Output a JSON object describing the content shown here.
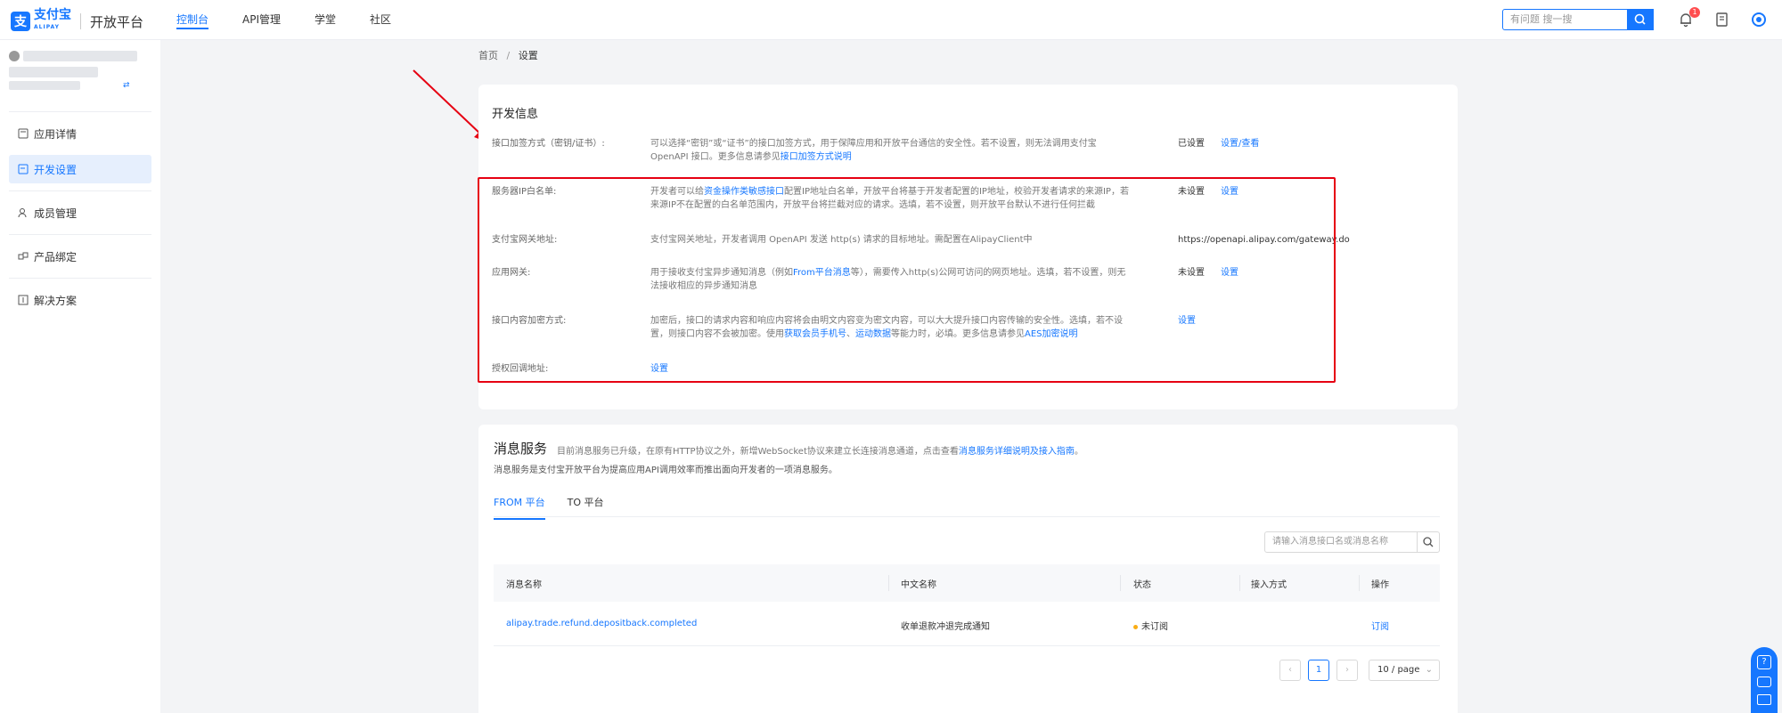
{
  "brand": {
    "mark": "支",
    "name": "支付宝",
    "sub": "ALIPAY",
    "product": "开放平台"
  },
  "nav": [
    {
      "label": "控制台",
      "active": true
    },
    {
      "label": "API管理",
      "active": false
    },
    {
      "label": "学堂",
      "active": false
    },
    {
      "label": "社区",
      "active": false
    }
  ],
  "search": {
    "placeholder": "有问题 搜一搜"
  },
  "notifications": {
    "count": "1"
  },
  "sidebar": {
    "items": [
      {
        "label": "应用详情",
        "active": false
      },
      {
        "label": "开发设置",
        "active": true
      },
      {
        "label": "成员管理",
        "active": false
      },
      {
        "label": "产品绑定",
        "active": false
      },
      {
        "label": "解决方案",
        "active": false
      }
    ]
  },
  "breadcrumb": {
    "home": "首页",
    "sep": "/",
    "current": "设置"
  },
  "dev": {
    "title": "开发信息",
    "rows": [
      {
        "label": "接口加签方式（密钥/证书）:",
        "desc": "可以选择“密钥”或“证书”的接口加签方式，用于保障应用和开放平台通信的安全性。若不设置，则无法调用支付宝 OpenAPI 接口。更多信息请参见",
        "desc_link": "接口加签方式说明",
        "status": "已设置",
        "action": "设置/查看"
      },
      {
        "label": "服务器IP白名单:",
        "desc_pre": "开发者可以给",
        "desc_link": "资金操作类敏感接口",
        "desc": "配置IP地址白名单，开放平台将基于开发者配置的IP地址，校验开发者请求的来源IP，若来源IP不在配置的白名单范围内，开放平台将拦截对应的请求。选填，若不设置，则开放平台默认不进行任何拦截",
        "status": "未设置",
        "action": "设置"
      },
      {
        "label": "支付宝网关地址:",
        "desc": "支付宝网关地址，开发者调用 OpenAPI 发送 http(s) 请求的目标地址。需配置在AlipayClient中",
        "status": "https://openapi.alipay.com/gateway.do"
      },
      {
        "label": "应用网关:",
        "desc_pre": "用于接收支付宝异步通知消息（例如",
        "desc_link": "From平台消息",
        "desc": "等），需要传入http(s)公网可访问的网页地址。选填，若不设置，则无法接收相应的异步通知消息",
        "status": "未设置",
        "action": "设置"
      },
      {
        "label": "接口内容加密方式:",
        "desc": "加密后，接口的请求内容和响应内容将会由明文内容变为密文内容，可以大大提升接口内容传输的安全性。选填，若不设置，则接口内容不会被加密。使用",
        "link1": "获取会员手机号",
        "sep": "、",
        "link2": "运动数据",
        "desc2": "等能力时，必填。更多信息请参见",
        "link3": "AES加密说明",
        "action": "设置"
      },
      {
        "label": "授权回调地址:",
        "action": "设置"
      }
    ]
  },
  "msg": {
    "title": "消息服务",
    "sub": "目前消息服务已升级，在原有HTTP协议之外，新增WebSocket协议来建立长连接消息通道，点击查看",
    "sub_link": "消息服务详细说明及接入指南",
    "sub_end": "。",
    "sub2": "消息服务是支付宝开放平台为提高应用API调用效率而推出面向开发者的一项消息服务。",
    "tabs": [
      {
        "label": "FROM 平台",
        "active": true
      },
      {
        "label": "TO 平台",
        "active": false
      }
    ],
    "search_placeholder": "请输入消息接口名或消息名称",
    "columns": [
      "消息名称",
      "中文名称",
      "状态",
      "接入方式",
      "操作"
    ],
    "rows": [
      {
        "name": "alipay.trade.refund.depositback.completed",
        "cn": "收单退款冲退完成通知",
        "status": "未订阅",
        "mode": "",
        "op": "订阅"
      }
    ],
    "pager": {
      "prev": "‹",
      "page": "1",
      "next": "›",
      "size": "10 / page"
    }
  },
  "colors": {
    "primary": "#1677ff",
    "alert": "#e60012",
    "pending": "#faad14"
  }
}
